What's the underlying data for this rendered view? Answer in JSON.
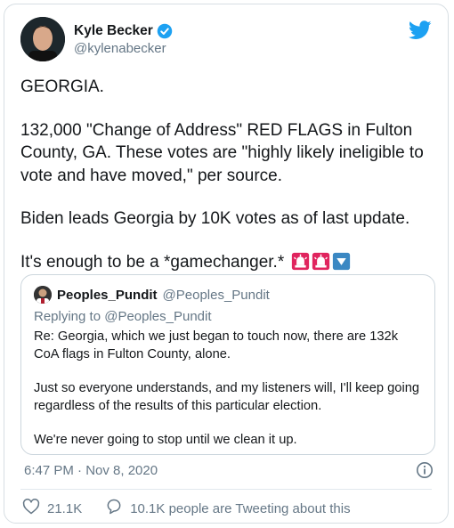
{
  "tweet": {
    "author": {
      "name": "Kyle Becker",
      "handle": "@kylenabecker"
    },
    "paragraphs": [
      "GEORGIA.",
      "132,000 \"Change of Address\" RED FLAGS in Fulton County, GA. These votes are \"highly likely ineligible to vote and have moved,\" per source.",
      "Biden leads Georgia by 10K votes as of last update.",
      "It's enough to be a *gamechanger.*"
    ],
    "emojis": [
      "police-car-light-icon",
      "police-car-light-icon",
      "down-arrow-button-icon"
    ],
    "timestamp": "6:47 PM · Nov 8, 2020",
    "likes": "21.1K",
    "tweeting_about": "10.1K people are Tweeting about this"
  },
  "quote": {
    "name": "Peoples_Pundit",
    "handle": "@Peoples_Pundit",
    "replying_to": "Replying to @Peoples_Pundit",
    "paragraphs": [
      "Re: Georgia, which we just began to touch now, there are 132k CoA flags in Fulton County, alone.",
      "Just so everyone understands, and my listeners will, I'll keep going regardless of the results of this particular election.",
      "We're never going to stop until we clean it up."
    ]
  },
  "colors": {
    "twitter_blue": "#1da1f2",
    "muted": "#657786",
    "text": "#14171a",
    "siren_red": "#e0245e"
  }
}
